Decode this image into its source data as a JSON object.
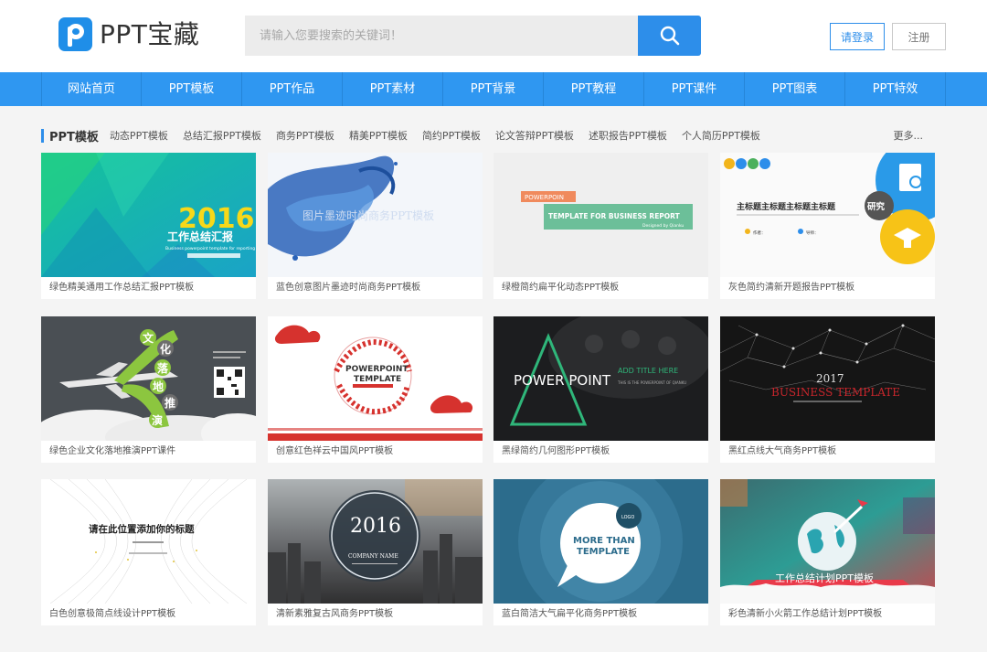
{
  "header": {
    "logo_text": "PPT宝藏",
    "search_placeholder": "请输入您要搜索的关键词！",
    "login_label": "请登录",
    "register_label": "注册"
  },
  "nav": {
    "items": [
      "网站首页",
      "PPT模板",
      "PPT作品",
      "PPT素材",
      "PPT背景",
      "PPT教程",
      "PPT课件",
      "PPT图表",
      "PPT特效"
    ]
  },
  "category": {
    "title": "PPT模板",
    "links": [
      "动态PPT模板",
      "总结汇报PPT模板",
      "商务PPT模板",
      "精美PPT模板",
      "简约PPT模板",
      "论文答辩PPT模板",
      "述职报告PPT模板",
      "个人简历PPT模板"
    ],
    "more": "更多..."
  },
  "cards": [
    {
      "caption": "绿色精美通用工作总结汇报PPT模板",
      "thumb": {
        "big": "2016",
        "title": "工作总结汇报",
        "sub": "Business powerpoint template for reporting"
      }
    },
    {
      "caption": "蓝色创意图片墨迹时尚商务PPT模板",
      "thumb": {
        "title": "图片墨迹时尚商务PPT模板"
      }
    },
    {
      "caption": "绿橙简约扁平化动态PPT模板",
      "thumb": {
        "tag": "POWERPOIN",
        "title": "TEMPLATE FOR BUSINESS REPORT",
        "sub": "Designed by Qianku"
      }
    },
    {
      "caption": "灰色简约清新开题报告PPT模板",
      "thumb": {
        "title": "主标题主标题主标题主标题",
        "badge": "研究",
        "labels": [
          "作者：",
          "导师："
        ]
      }
    },
    {
      "caption": "绿色企业文化落地推演PPT课件",
      "thumb": {
        "chars": [
          "文",
          "化",
          "落",
          "地",
          "推",
          "演"
        ]
      }
    },
    {
      "caption": "创意红色祥云中国风PPT模板",
      "thumb": {
        "title": "POWERPOINT",
        "sub": "TEMPLATE"
      }
    },
    {
      "caption": "黑绿简约几何图形PPT模板",
      "thumb": {
        "title": "POWER POINT",
        "sub": "ADD TITLE HERE",
        "small": "THIS IS THE POWERPOINT OF QIANKU"
      }
    },
    {
      "caption": "黑红点线大气商务PPT模板",
      "thumb": {
        "year": "2017",
        "title": "BUSINESS TEMPLATE"
      }
    },
    {
      "caption": "白色创意极简点线设计PPT模板",
      "thumb": {
        "title": "请在此位置添加你的标题"
      }
    },
    {
      "caption": "清新素雅复古风商务PPT模板",
      "thumb": {
        "year": "2016",
        "sub": "COMPANY NAME"
      }
    },
    {
      "caption": "蓝白简洁大气扁平化商务PPT模板",
      "thumb": {
        "title1": "MORE THAN",
        "title2": "TEMPLATE",
        "logo": "LOGO"
      }
    },
    {
      "caption": "彩色清新小火箭工作总结计划PPT模板",
      "thumb": {
        "title": "工作总结计划PPT模板"
      }
    }
  ],
  "colors": {
    "accent": "#2d8eea",
    "nav": "#2f97f1"
  }
}
